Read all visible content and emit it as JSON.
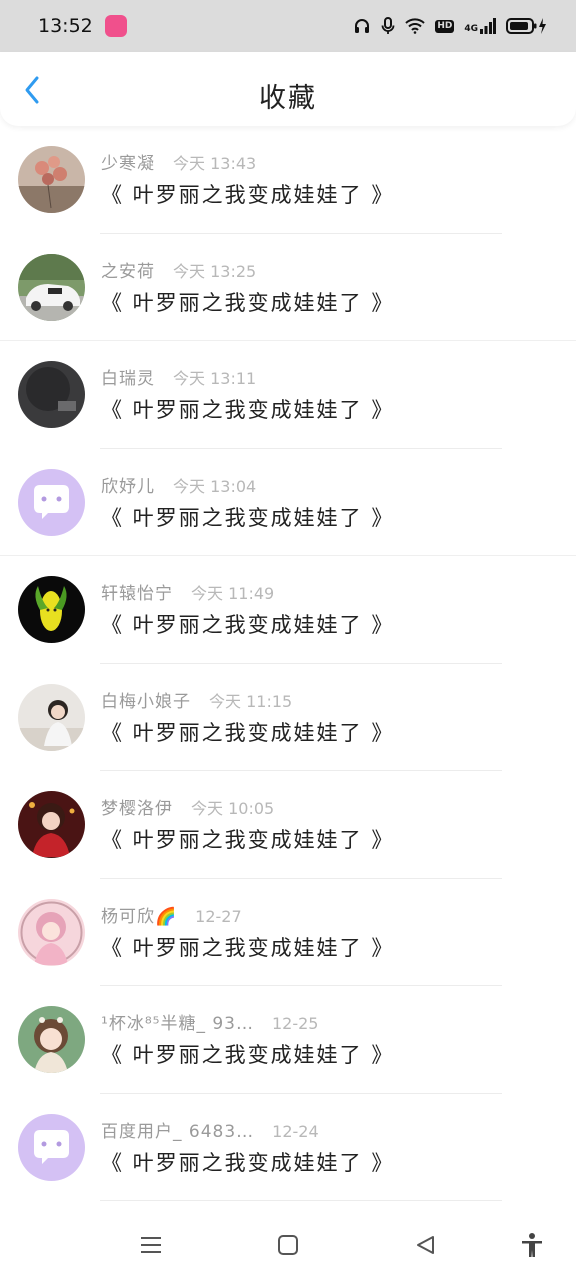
{
  "status_bar": {
    "time": "13:52",
    "app_badge_text": "bilibili",
    "hd_label": "HD",
    "network_label": "4G"
  },
  "header": {
    "title": "收藏",
    "back_icon": "chevron-left-icon",
    "accent_color": "#2f9bf0"
  },
  "items": [
    {
      "name": "少寒凝",
      "time": "今天 13:43",
      "title": "《 叶罗丽之我变成娃娃了 》",
      "avatar": "balloons-photo"
    },
    {
      "name": "之安荷",
      "time": "今天 13:25",
      "title": "《 叶罗丽之我变成娃娃了 》",
      "avatar": "white-car-photo"
    },
    {
      "name": "白瑞灵",
      "time": "今天 13:11",
      "title": "《 叶罗丽之我变成娃娃了 》",
      "avatar": "dark-photo"
    },
    {
      "name": "欣妤儿",
      "time": "今天 13:04",
      "title": "《 叶罗丽之我变成娃娃了 》",
      "avatar": "default-chat-avatar"
    },
    {
      "name": "轩辕怡宁",
      "time": "今天 11:49",
      "title": "《 叶罗丽之我变成娃娃了 》",
      "avatar": "corn-cartoon"
    },
    {
      "name": "白梅小娘子",
      "time": "今天 11:15",
      "title": "《 叶罗丽之我变成娃娃了 》",
      "avatar": "girl-photo"
    },
    {
      "name": "梦樱洛伊",
      "time": "今天 10:05",
      "title": "《 叶罗丽之我变成娃娃了 》",
      "avatar": "anime-girl-red"
    },
    {
      "name": "杨可欣🌈",
      "time": "12-27",
      "title": "《 叶罗丽之我变成娃娃了 》",
      "avatar": "anime-girl-pink"
    },
    {
      "name": "¹杯冰⁸⁵半糖_ 93…",
      "time": "12-25",
      "title": "《 叶罗丽之我变成娃娃了 》",
      "avatar": "anime-girl-green"
    },
    {
      "name": "百度用户_ 6483…",
      "time": "12-24",
      "title": "《 叶罗丽之我变成娃娃了 》",
      "avatar": "default-chat-avatar"
    }
  ],
  "nav": {
    "menu_icon": "menu-icon",
    "home_icon": "square-home-icon",
    "back_icon": "triangle-back-icon",
    "accessibility_icon": "accessibility-icon"
  }
}
